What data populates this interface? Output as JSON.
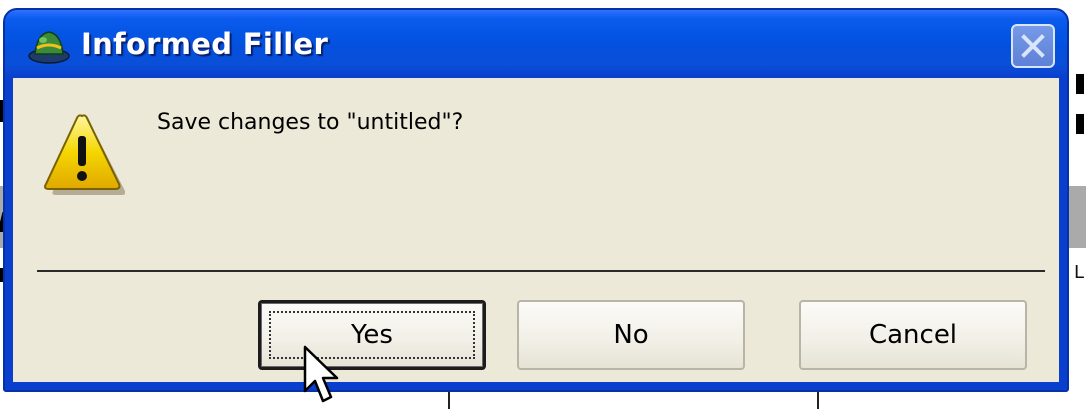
{
  "dialog": {
    "title": "Informed Filler",
    "message": "Save changes to \"untitled\"?",
    "icon": "warning-icon",
    "buttons": {
      "yes": "Yes",
      "no": "No",
      "cancel": "Cancel"
    },
    "default_button": "yes"
  },
  "background": {
    "right_fragment_letter": "L"
  },
  "colors": {
    "titlebar": "#0450de",
    "client": "#ece9d8",
    "warning_fill": "#f5d600"
  }
}
